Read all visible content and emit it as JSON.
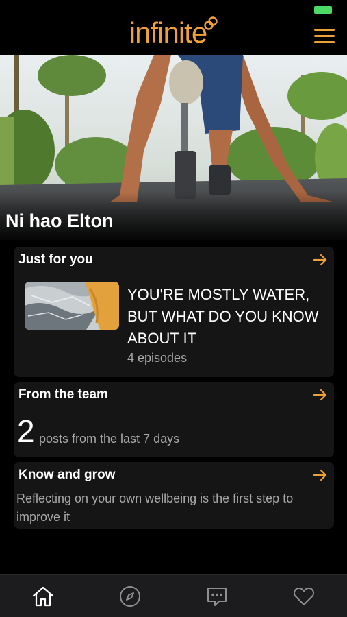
{
  "header": {
    "logo_text": "infinite",
    "menu_icon": "hamburger-menu-icon"
  },
  "hero": {
    "greeting": "Ni hao Elton"
  },
  "cards": {
    "just_for_you": {
      "title": "Just for you",
      "episode_title": "YOU'RE MOSTLY WATER, BUT WHAT DO YOU KNOW ABOUT IT",
      "episode_count": "4 episodes"
    },
    "from_team": {
      "title": "From the team",
      "count": "2",
      "posts_text": "posts from the last 7 days"
    },
    "know_grow": {
      "title": "Know and grow",
      "description": "Reflecting on your own wellbeing is the first step to improve it"
    }
  },
  "tabbar": {
    "icons": [
      "home-icon",
      "compass-icon",
      "chat-icon",
      "heart-icon"
    ]
  },
  "colors": {
    "accent": "#f0a03a",
    "background": "#000000",
    "card": "#151515",
    "muted_text": "#a8a8a8",
    "battery": "#4cd964"
  }
}
